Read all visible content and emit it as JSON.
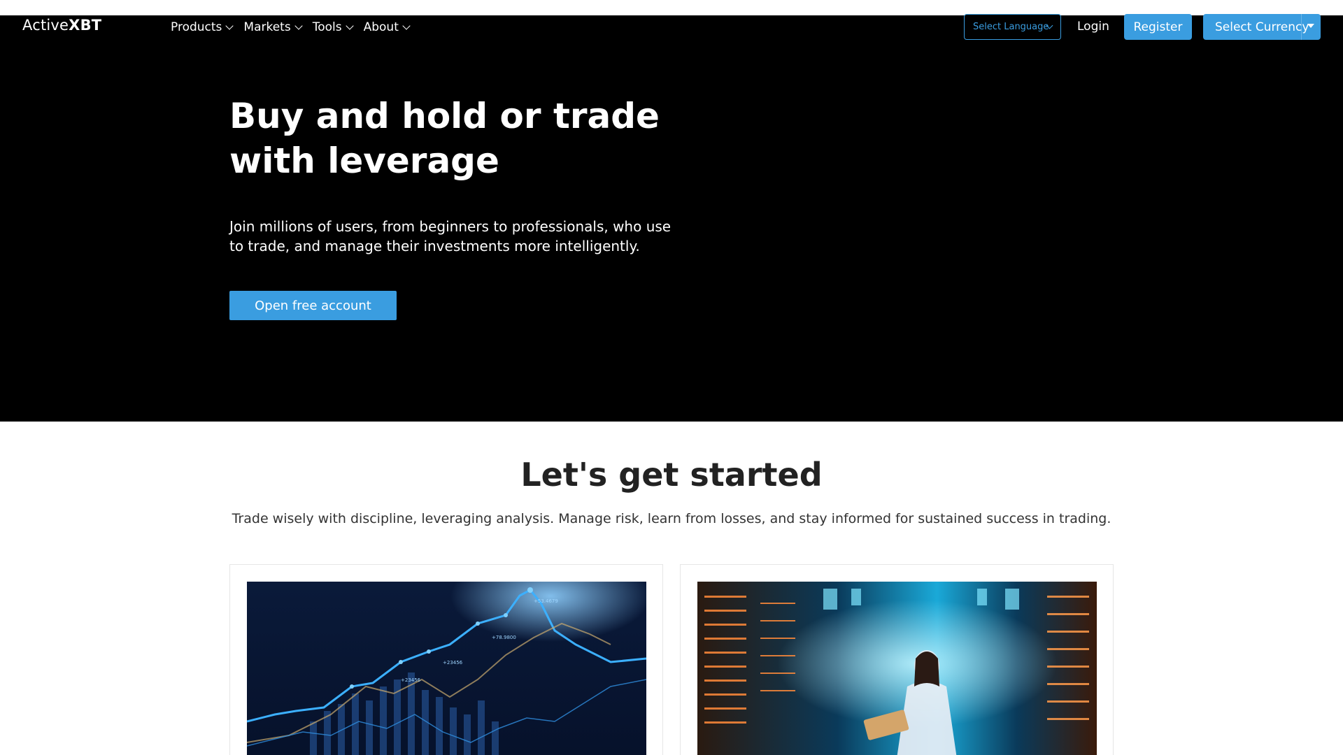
{
  "header": {
    "logo_light": "Active",
    "logo_bold": "XBT",
    "menu": [
      {
        "label": "Products"
      },
      {
        "label": "Markets"
      },
      {
        "label": "Tools"
      },
      {
        "label": "About"
      }
    ],
    "language_select": "Select Language",
    "login": "Login",
    "register": "Register",
    "currency_select": "Select Currency"
  },
  "hero": {
    "title_line1": "Buy and hold or trade",
    "title_line2": "with leverage",
    "subtitle": "Join millions of users, from beginners to professionals, who use to trade, and manage their investments more intelligently.",
    "cta": "Open free account"
  },
  "section": {
    "title": "Let's get started",
    "subtitle": "Trade wisely with discipline, leveraging analysis. Manage risk, learn from losses, and stay informed for sustained success in trading."
  },
  "cards": [
    {
      "image": "stock-chart-image",
      "labels": [
        "+78.9800",
        "+23456",
        "+23456",
        "+53.4679"
      ]
    },
    {
      "image": "datacenter-woman-image"
    }
  ],
  "colors": {
    "accent": "#3a9de0",
    "hero_bg": "#000000"
  }
}
